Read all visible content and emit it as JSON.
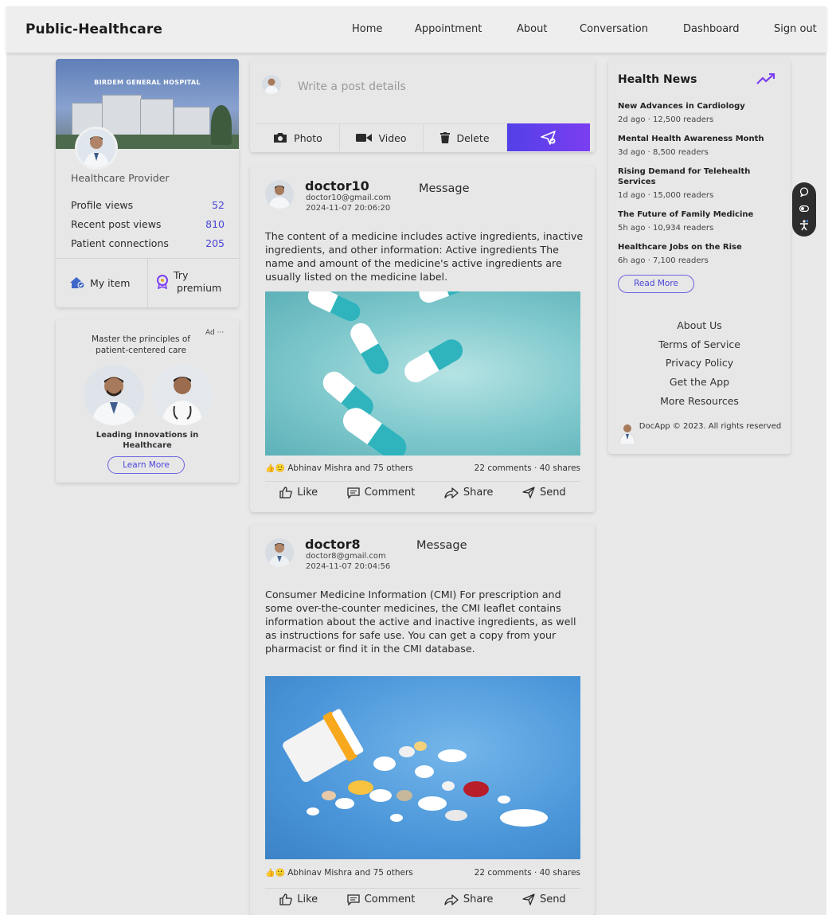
{
  "nav": {
    "brand": "Public-Healthcare",
    "links": [
      "Home",
      "Appointment",
      "About",
      "Conversation",
      "Dashboard",
      "Sign out"
    ]
  },
  "profile": {
    "cover_title": "BIRDEM GENERAL HOSPITAL",
    "role": "Healthcare Provider",
    "stats": [
      {
        "label": "Profile views",
        "value": "52"
      },
      {
        "label": "Recent post views",
        "value": "810"
      },
      {
        "label": "Patient connections",
        "value": "205"
      }
    ],
    "my_item": "My item",
    "try_premium_1": "Try",
    "try_premium_2": "premium"
  },
  "ad": {
    "line1": "Master the principles of",
    "line2": "patient-centered care",
    "tag": "Ad",
    "more": "···",
    "caption1": "Leading Innovations in",
    "caption2": "Healthcare",
    "button": "Learn More"
  },
  "composer": {
    "placeholder": "Write a post details",
    "photo": "Photo",
    "video": "Video",
    "delete": "Delete"
  },
  "posts": [
    {
      "name": "doctor10",
      "email": "doctor10@gmail.com",
      "date": "2024-11-07 20:06:20",
      "message": "Message",
      "body": "The content of a medicine includes active ingredients, inactive ingredients, and other information: Active ingredients The name and amount of the medicine's active ingredients are usually listed on the medicine label.",
      "reactions": "Abhinav Mishra and 75 others",
      "counts": "22 comments · 40 shares",
      "like": "Like",
      "comment": "Comment",
      "share": "Share",
      "send": "Send"
    },
    {
      "name": "doctor8",
      "email": "doctor8@gmail.com",
      "date": "2024-11-07 20:04:56",
      "message": "Message",
      "body": "Consumer Medicine Information (CMI) For prescription and some over-the-counter medicines, the CMI leaflet contains information about the active and inactive ingredients, as well as instructions for safe use. You can get a copy from your pharmacist or find it in the CMI database.",
      "reactions": "Abhinav Mishra and 75 others",
      "counts": "22 comments · 40 shares",
      "like": "Like",
      "comment": "Comment",
      "share": "Share",
      "send": "Send"
    }
  ],
  "news": {
    "title": "Health News",
    "items": [
      {
        "title": "New Advances in Cardiology",
        "meta": "2d ago · 12,500 readers"
      },
      {
        "title": "Mental Health Awareness Month",
        "meta": "3d ago · 8,500 readers"
      },
      {
        "title": "Rising Demand for Telehealth Services",
        "meta": "1d ago · 15,000 readers"
      },
      {
        "title": "The Future of Family Medicine",
        "meta": "5h ago · 10,934 readers"
      },
      {
        "title": "Healthcare Jobs on the Rise",
        "meta": "6h ago · 7,100 readers"
      }
    ],
    "read_more": "Read More"
  },
  "footer": {
    "links": [
      "About Us",
      "Terms of Service",
      "Privacy Policy",
      "Get the App",
      "More Resources"
    ],
    "copyright": "DocApp © 2023. All rights reserved"
  },
  "colors": {
    "accent": "#4a46d9",
    "send_gradient_start": "#5340e8",
    "send_gradient_end": "#7b3ef0",
    "teal_pill": "#2fb4bd",
    "blue_background": "#4a95d9"
  }
}
